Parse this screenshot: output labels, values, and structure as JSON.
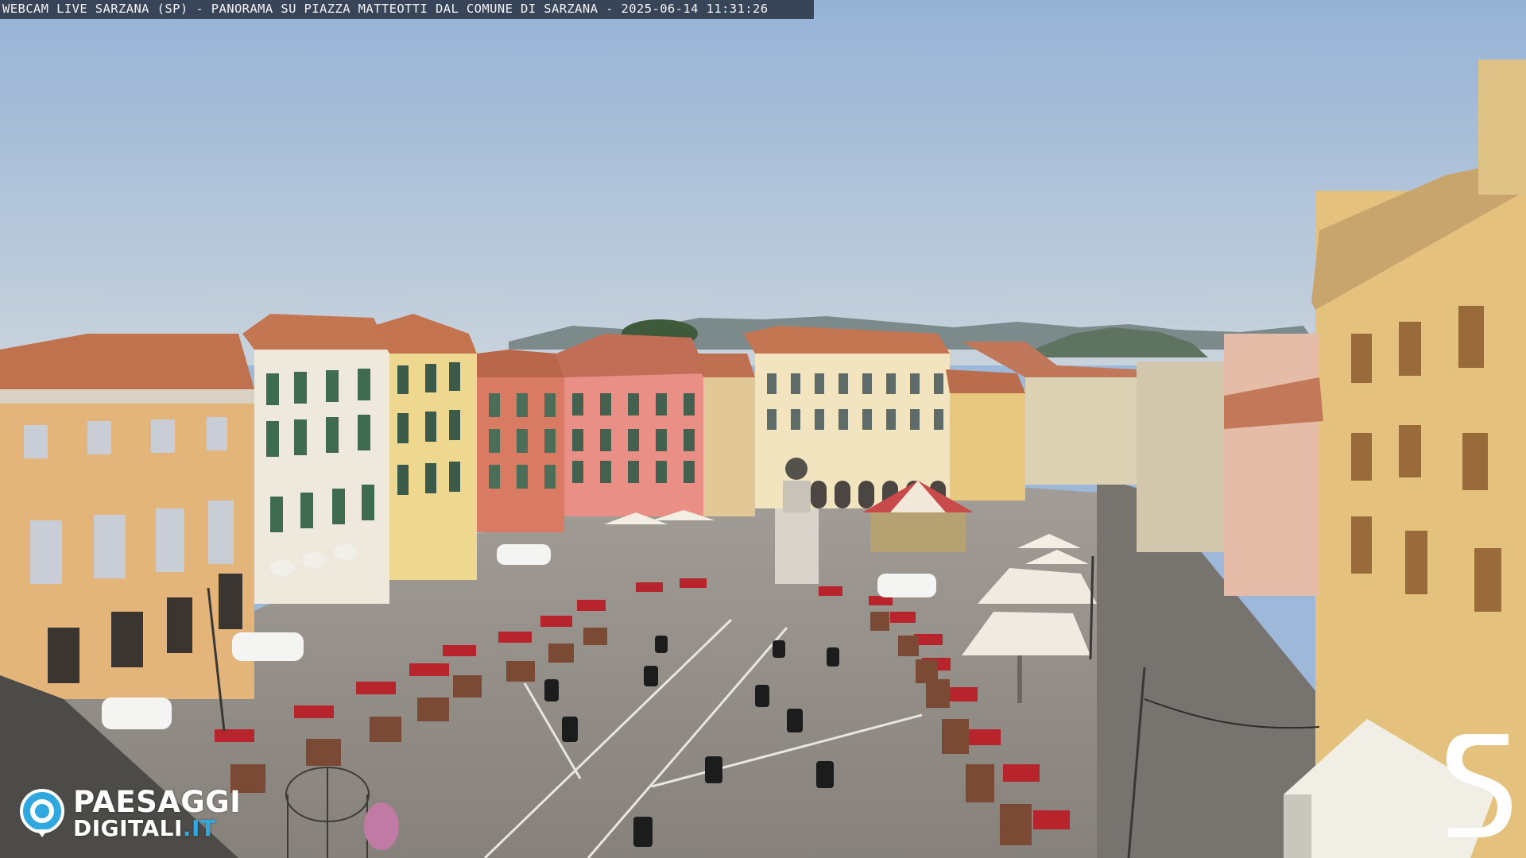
{
  "overlay": {
    "caption": "WEBCAM LIVE SARZANA (SP) - PANORAMA SU PIAZZA MATTEOTTI DAL COMUNE DI SARZANA - 2025-06-14  11:31:26"
  },
  "watermark": {
    "line1": "PAESAGGI",
    "line2_main": "DIGITALI",
    "line2_tld": ".IT",
    "icon": "camera-lens-icon"
  },
  "corner_logo": {
    "icon": "letter-s-logo"
  },
  "colors": {
    "sky": "#9db8d8",
    "pavement": "#8f8b86",
    "logo_accent": "#2fa8e0"
  }
}
